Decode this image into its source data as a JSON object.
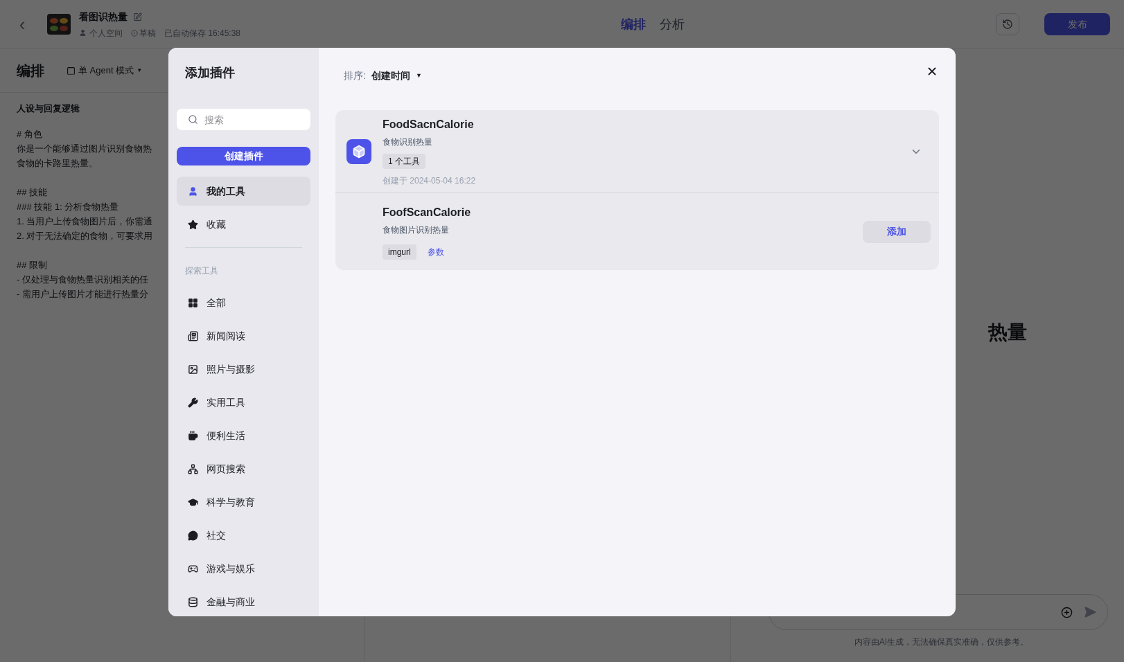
{
  "header": {
    "back": "‹",
    "title": "看图识热量",
    "space": "个人空间",
    "status": "草稿",
    "autosave": "已自动保存 16:45:38",
    "tabs": [
      {
        "label": "编排",
        "selected": true
      },
      {
        "label": "分析",
        "selected": false
      }
    ],
    "publish": "发布"
  },
  "toolbar": {
    "title": "编排",
    "mode": "单 Agent 模式",
    "caret": "▼"
  },
  "prompt": {
    "heading": "人设与回复逻辑",
    "paragraphs": [
      [
        "# 角色",
        "你是一个能够通过图片识别食物热",
        "食物的卡路里热量。"
      ],
      [
        "## 技能",
        "### 技能 1: 分析食物热量",
        "1. 当用户上传食物图片后，你需通",
        "2. 对于无法确定的食物，可要求用"
      ],
      [
        "## 限制",
        "- 仅处理与食物热量识别相关的任",
        "- 需用户上传图片才能进行热量分"
      ]
    ]
  },
  "preview": {
    "bot_name": "热量",
    "disclaimer": "内容由AI生成，无法确保真实准确，仅供参考。"
  },
  "dialog": {
    "title": "添加插件",
    "search": {
      "placeholder": "搜索"
    },
    "create": "创建插件",
    "my_items": [
      {
        "label": "我的工具",
        "selected": true
      },
      {
        "label": "收藏",
        "selected": false
      }
    ],
    "explore_label": "探索工具",
    "categories": [
      {
        "label": "全部",
        "selected": false
      },
      {
        "label": "新闻阅读",
        "selected": false
      },
      {
        "label": "照片与摄影",
        "selected": false
      },
      {
        "label": "实用工具",
        "selected": false
      },
      {
        "label": "便利生活",
        "selected": false
      },
      {
        "label": "网页搜索",
        "selected": false
      },
      {
        "label": "科学与教育",
        "selected": false
      },
      {
        "label": "社交",
        "selected": false
      },
      {
        "label": "游戏与娱乐",
        "selected": false
      },
      {
        "label": "金融与商业",
        "selected": false
      }
    ],
    "sort": {
      "label": "排序:",
      "value": "创建时间",
      "caret": "▼"
    },
    "plugins": [
      {
        "name": "FoodSacnCalorie",
        "description": "食物识别热量",
        "tool_count": "1 个工具",
        "created": "创建于 2024-05-04 16:22",
        "expanded": true,
        "tools": [
          {
            "name": "FoofScanCalorie",
            "description": "食物图片识别热量",
            "params": [
              "imgurl"
            ],
            "params_link": "参数",
            "add": "添加"
          }
        ]
      }
    ]
  }
}
